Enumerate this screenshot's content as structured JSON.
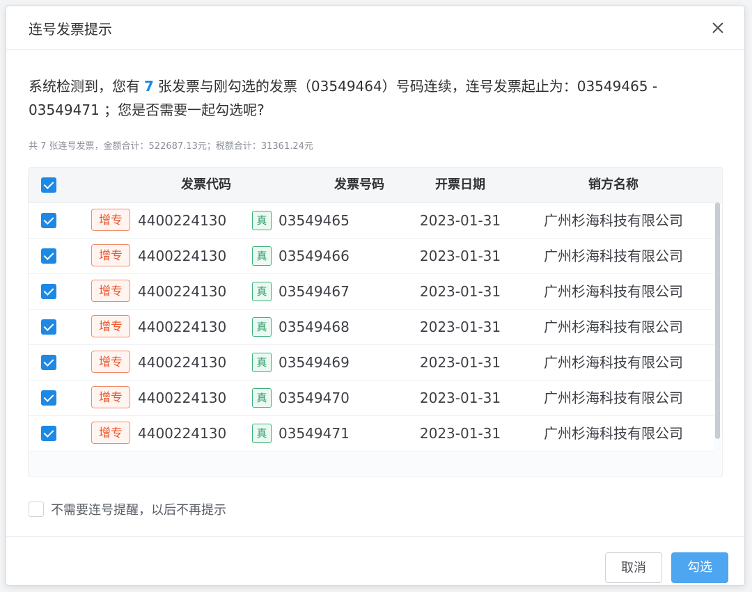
{
  "dialog": {
    "title": "连号发票提示",
    "message_prefix": "系统检测到，您有",
    "count": "7",
    "message_suffix": "张发票与刚勾选的发票（03549464）号码连续，连号发票起止为：03549465 - 03549471 ；您是否需要一起勾选呢?",
    "summary": "共 7 张连号发票，金额合计：522687.13元；税额合计：31361.24元"
  },
  "table": {
    "headers": {
      "code": "发票代码",
      "number": "发票号码",
      "date": "开票日期",
      "seller": "销方名称"
    },
    "rows": [
      {
        "type_tag": "增专",
        "code": "4400224130",
        "num_tag": "真",
        "number": "03549465",
        "date": "2023-01-31",
        "seller": "广州杉海科技有限公司"
      },
      {
        "type_tag": "增专",
        "code": "4400224130",
        "num_tag": "真",
        "number": "03549466",
        "date": "2023-01-31",
        "seller": "广州杉海科技有限公司"
      },
      {
        "type_tag": "增专",
        "code": "4400224130",
        "num_tag": "真",
        "number": "03549467",
        "date": "2023-01-31",
        "seller": "广州杉海科技有限公司"
      },
      {
        "type_tag": "增专",
        "code": "4400224130",
        "num_tag": "真",
        "number": "03549468",
        "date": "2023-01-31",
        "seller": "广州杉海科技有限公司"
      },
      {
        "type_tag": "增专",
        "code": "4400224130",
        "num_tag": "真",
        "number": "03549469",
        "date": "2023-01-31",
        "seller": "广州杉海科技有限公司"
      },
      {
        "type_tag": "增专",
        "code": "4400224130",
        "num_tag": "真",
        "number": "03549470",
        "date": "2023-01-31",
        "seller": "广州杉海科技有限公司"
      },
      {
        "type_tag": "增专",
        "code": "4400224130",
        "num_tag": "真",
        "number": "03549471",
        "date": "2023-01-31",
        "seller": "广州杉海科技有限公司"
      }
    ]
  },
  "no_remind_label": "不需要连号提醒，以后不再提示",
  "buttons": {
    "cancel": "取消",
    "confirm": "勾选"
  },
  "colors": {
    "accent": "#1e88e5",
    "tag_zz": "#e9572f",
    "tag_zhen": "#2e9e69"
  }
}
